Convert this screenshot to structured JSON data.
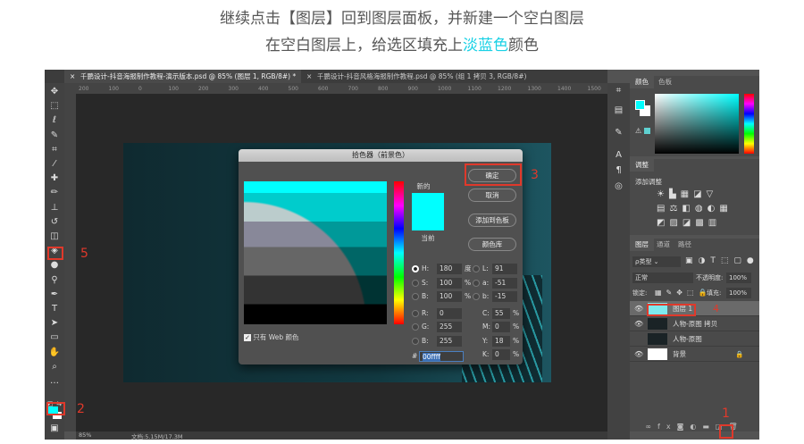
{
  "caption": {
    "line1": "继续点击【图层】回到图层面板，并新建一个空白图层",
    "line2_pre": "在空白图层上，给选区填充上",
    "line2_hl": "淡蓝色",
    "line2_post": "颜色",
    "highlight_color": "#1ad1e5"
  },
  "tabs": [
    {
      "label": "千鹏设计-抖音海报制作教程-演示版本.psd @ 85% (图层 1, RGB/8#) *",
      "active": true
    },
    {
      "label": "千鹏设计-抖音风格海报制作教程.psd @ 85% (组 1 拷贝 3, RGB/8#)",
      "active": false
    }
  ],
  "ruler_ticks": [
    "200",
    "100",
    "0",
    "100",
    "200",
    "300",
    "400",
    "500",
    "600",
    "700",
    "800",
    "900",
    "1000",
    "1100",
    "1200",
    "1300",
    "1400",
    "1500"
  ],
  "status": {
    "zoom": "85%",
    "doc": "文档:5.15M/17.3M"
  },
  "dialog": {
    "title": "拾色器（前景色）",
    "ok": "确定",
    "cancel": "取消",
    "add_swatch": "添加到色板",
    "library": "颜色库",
    "new_label": "新的",
    "current_label": "当前",
    "new_color": "#00ffff",
    "web_only": "只有 Web 颜色",
    "web_only_checked": true,
    "fields_left": [
      {
        "k": "H:",
        "v": "180",
        "u": "度",
        "selected": true
      },
      {
        "k": "S:",
        "v": "100",
        "u": "%"
      },
      {
        "k": "B:",
        "v": "100",
        "u": "%"
      },
      {
        "k": "R:",
        "v": "0",
        "u": ""
      },
      {
        "k": "G:",
        "v": "255",
        "u": ""
      },
      {
        "k": "B:",
        "v": "255",
        "u": ""
      }
    ],
    "fields_right": [
      {
        "k": "L:",
        "v": "91",
        "u": ""
      },
      {
        "k": "a:",
        "v": "-51",
        "u": ""
      },
      {
        "k": "b:",
        "v": "-15",
        "u": ""
      },
      {
        "k": "C:",
        "v": "55",
        "u": "%"
      },
      {
        "k": "M:",
        "v": "0",
        "u": "%"
      },
      {
        "k": "Y:",
        "v": "18",
        "u": "%"
      },
      {
        "k": "K:",
        "v": "0",
        "u": "%"
      }
    ],
    "hex_label": "#",
    "hex": "00ffff"
  },
  "color_panel": {
    "tabs": [
      "颜色",
      "色板"
    ],
    "fg": "#00ffff",
    "bg": "#ffffff"
  },
  "adjust_panel": {
    "tab": "调整",
    "add_label": "添加调整"
  },
  "layers_panel": {
    "tabs": [
      "图层",
      "通道",
      "路径"
    ],
    "filter": "ρ类型",
    "blend": "正常",
    "opacity_label": "不透明度:",
    "opacity": "100%",
    "lock_label": "锁定:",
    "fill_label": "填充:",
    "fill": "100%",
    "layers": [
      {
        "name": "图层 1",
        "visible": true,
        "selected": true,
        "thumb": "#7fe9ee"
      },
      {
        "name": "人物-原图 拷贝",
        "visible": true,
        "thumb": "#1a2326"
      },
      {
        "name": "人物-原图",
        "visible": false,
        "thumb": "#1a2326"
      },
      {
        "name": "背景",
        "visible": true,
        "thumb": "#ffffff",
        "locked": true
      }
    ],
    "bottom_icons": [
      "link-icon",
      "fx-icon",
      "mask-icon",
      "adjustment-icon",
      "folder-icon",
      "new-layer-icon",
      "trash-icon"
    ]
  },
  "steps": [
    "1",
    "2",
    "3",
    "4",
    "5"
  ]
}
